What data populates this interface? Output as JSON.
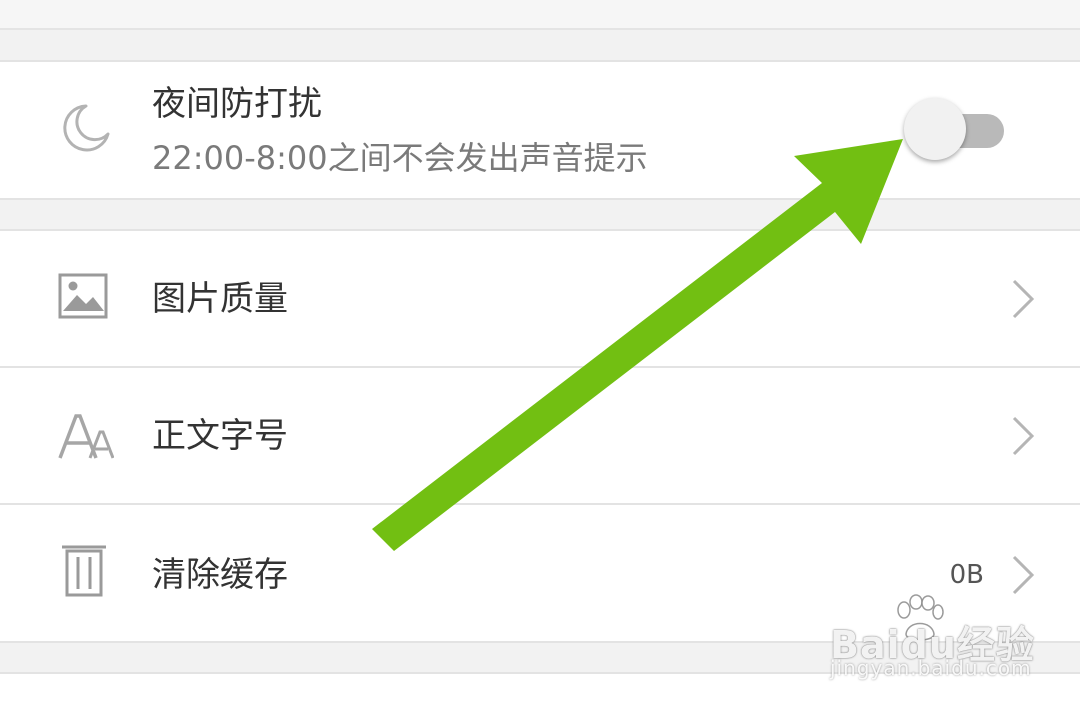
{
  "night_mode": {
    "title": "夜间防打扰",
    "subtitle": "22:00-8:00之间不会发出声音提示",
    "icon": "moon-icon",
    "toggle_on": false
  },
  "menu": {
    "items": [
      {
        "label": "图片质量",
        "icon": "image-icon",
        "value": ""
      },
      {
        "label": "正文字号",
        "icon": "font-size-icon",
        "value": ""
      },
      {
        "label": "清除缓存",
        "icon": "trash-icon",
        "value": "0B"
      }
    ]
  },
  "annotation": {
    "arrow_color": "#72bf12"
  },
  "watermark": {
    "brand_latin": "Bai",
    "brand_du": "du",
    "brand_cn": "经验",
    "url": "jingyan.baidu.com"
  },
  "colors": {
    "background": "#f2f2f2",
    "card": "#ffffff",
    "divider": "#e3e3e3",
    "title_text": "#333333",
    "subtitle_text": "#7a7a7a",
    "icon_gray": "#9a9a9a",
    "toggle_track_off": "#b9b9b9",
    "toggle_knob": "#f1f1f1"
  }
}
